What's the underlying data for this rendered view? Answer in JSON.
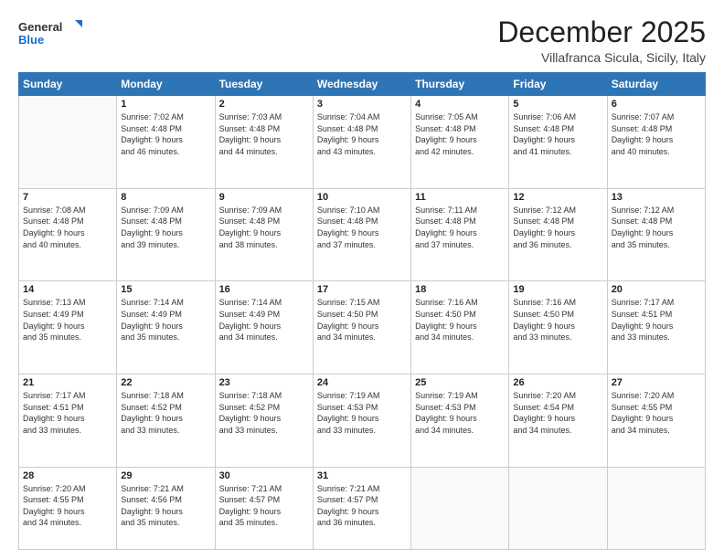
{
  "header": {
    "logo_general": "General",
    "logo_blue": "Blue",
    "month_title": "December 2025",
    "location": "Villafranca Sicula, Sicily, Italy"
  },
  "weekdays": [
    "Sunday",
    "Monday",
    "Tuesday",
    "Wednesday",
    "Thursday",
    "Friday",
    "Saturday"
  ],
  "weeks": [
    [
      {
        "day": "",
        "info": ""
      },
      {
        "day": "1",
        "info": "Sunrise: 7:02 AM\nSunset: 4:48 PM\nDaylight: 9 hours\nand 46 minutes."
      },
      {
        "day": "2",
        "info": "Sunrise: 7:03 AM\nSunset: 4:48 PM\nDaylight: 9 hours\nand 44 minutes."
      },
      {
        "day": "3",
        "info": "Sunrise: 7:04 AM\nSunset: 4:48 PM\nDaylight: 9 hours\nand 43 minutes."
      },
      {
        "day": "4",
        "info": "Sunrise: 7:05 AM\nSunset: 4:48 PM\nDaylight: 9 hours\nand 42 minutes."
      },
      {
        "day": "5",
        "info": "Sunrise: 7:06 AM\nSunset: 4:48 PM\nDaylight: 9 hours\nand 41 minutes."
      },
      {
        "day": "6",
        "info": "Sunrise: 7:07 AM\nSunset: 4:48 PM\nDaylight: 9 hours\nand 40 minutes."
      }
    ],
    [
      {
        "day": "7",
        "info": "Sunrise: 7:08 AM\nSunset: 4:48 PM\nDaylight: 9 hours\nand 40 minutes."
      },
      {
        "day": "8",
        "info": "Sunrise: 7:09 AM\nSunset: 4:48 PM\nDaylight: 9 hours\nand 39 minutes."
      },
      {
        "day": "9",
        "info": "Sunrise: 7:09 AM\nSunset: 4:48 PM\nDaylight: 9 hours\nand 38 minutes."
      },
      {
        "day": "10",
        "info": "Sunrise: 7:10 AM\nSunset: 4:48 PM\nDaylight: 9 hours\nand 37 minutes."
      },
      {
        "day": "11",
        "info": "Sunrise: 7:11 AM\nSunset: 4:48 PM\nDaylight: 9 hours\nand 37 minutes."
      },
      {
        "day": "12",
        "info": "Sunrise: 7:12 AM\nSunset: 4:48 PM\nDaylight: 9 hours\nand 36 minutes."
      },
      {
        "day": "13",
        "info": "Sunrise: 7:12 AM\nSunset: 4:48 PM\nDaylight: 9 hours\nand 35 minutes."
      }
    ],
    [
      {
        "day": "14",
        "info": "Sunrise: 7:13 AM\nSunset: 4:49 PM\nDaylight: 9 hours\nand 35 minutes."
      },
      {
        "day": "15",
        "info": "Sunrise: 7:14 AM\nSunset: 4:49 PM\nDaylight: 9 hours\nand 35 minutes."
      },
      {
        "day": "16",
        "info": "Sunrise: 7:14 AM\nSunset: 4:49 PM\nDaylight: 9 hours\nand 34 minutes."
      },
      {
        "day": "17",
        "info": "Sunrise: 7:15 AM\nSunset: 4:50 PM\nDaylight: 9 hours\nand 34 minutes."
      },
      {
        "day": "18",
        "info": "Sunrise: 7:16 AM\nSunset: 4:50 PM\nDaylight: 9 hours\nand 34 minutes."
      },
      {
        "day": "19",
        "info": "Sunrise: 7:16 AM\nSunset: 4:50 PM\nDaylight: 9 hours\nand 33 minutes."
      },
      {
        "day": "20",
        "info": "Sunrise: 7:17 AM\nSunset: 4:51 PM\nDaylight: 9 hours\nand 33 minutes."
      }
    ],
    [
      {
        "day": "21",
        "info": "Sunrise: 7:17 AM\nSunset: 4:51 PM\nDaylight: 9 hours\nand 33 minutes."
      },
      {
        "day": "22",
        "info": "Sunrise: 7:18 AM\nSunset: 4:52 PM\nDaylight: 9 hours\nand 33 minutes."
      },
      {
        "day": "23",
        "info": "Sunrise: 7:18 AM\nSunset: 4:52 PM\nDaylight: 9 hours\nand 33 minutes."
      },
      {
        "day": "24",
        "info": "Sunrise: 7:19 AM\nSunset: 4:53 PM\nDaylight: 9 hours\nand 33 minutes."
      },
      {
        "day": "25",
        "info": "Sunrise: 7:19 AM\nSunset: 4:53 PM\nDaylight: 9 hours\nand 34 minutes."
      },
      {
        "day": "26",
        "info": "Sunrise: 7:20 AM\nSunset: 4:54 PM\nDaylight: 9 hours\nand 34 minutes."
      },
      {
        "day": "27",
        "info": "Sunrise: 7:20 AM\nSunset: 4:55 PM\nDaylight: 9 hours\nand 34 minutes."
      }
    ],
    [
      {
        "day": "28",
        "info": "Sunrise: 7:20 AM\nSunset: 4:55 PM\nDaylight: 9 hours\nand 34 minutes."
      },
      {
        "day": "29",
        "info": "Sunrise: 7:21 AM\nSunset: 4:56 PM\nDaylight: 9 hours\nand 35 minutes."
      },
      {
        "day": "30",
        "info": "Sunrise: 7:21 AM\nSunset: 4:57 PM\nDaylight: 9 hours\nand 35 minutes."
      },
      {
        "day": "31",
        "info": "Sunrise: 7:21 AM\nSunset: 4:57 PM\nDaylight: 9 hours\nand 36 minutes."
      },
      {
        "day": "",
        "info": ""
      },
      {
        "day": "",
        "info": ""
      },
      {
        "day": "",
        "info": ""
      }
    ]
  ]
}
